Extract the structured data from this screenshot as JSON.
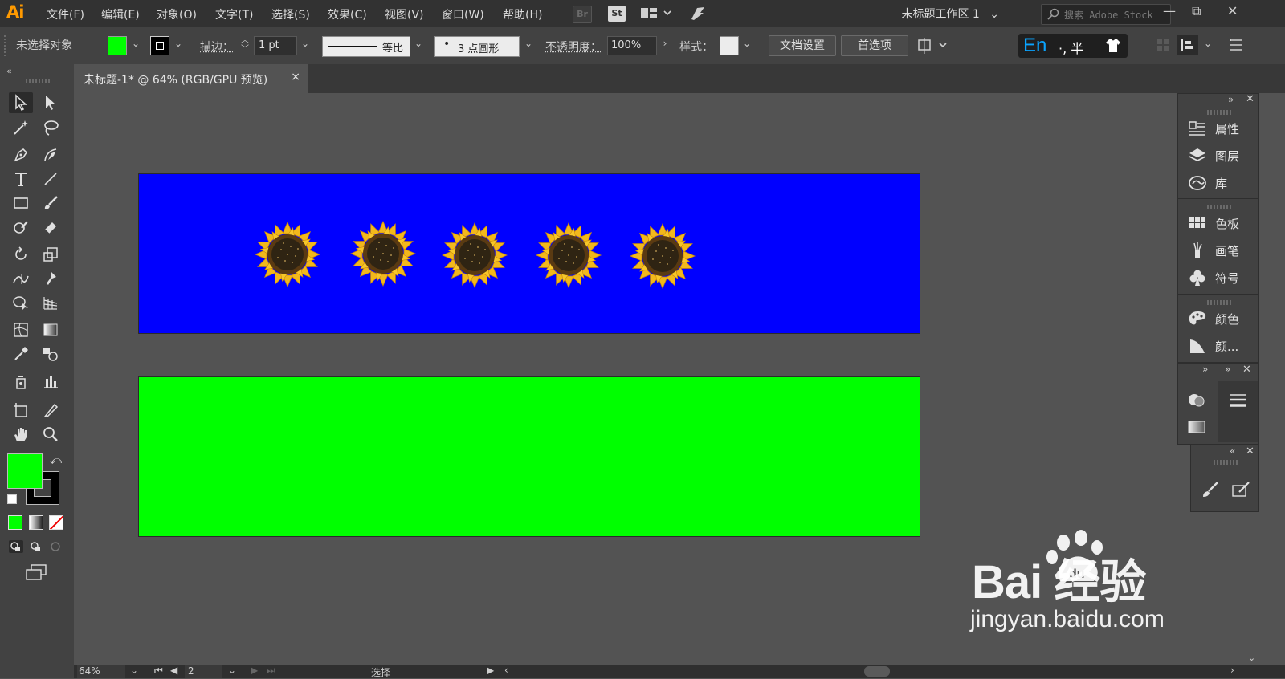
{
  "app": {
    "logo": "Ai",
    "menus": [
      "文件(F)",
      "编辑(E)",
      "对象(O)",
      "文字(T)",
      "选择(S)",
      "效果(C)",
      "视图(V)",
      "窗口(W)",
      "帮助(H)"
    ],
    "bridge_button": "Br",
    "stock_button": "St",
    "workspace": "未标题工作区 1",
    "search_placeholder": "搜索 Adobe Stock"
  },
  "control_bar": {
    "selection_status": "未选择对象",
    "fill_color": "#00ff00",
    "stroke_label": "描边：",
    "stroke_weight": "1 pt",
    "stroke_profile": "等比",
    "brush": "3 点圆形",
    "opacity_label": "不透明度：",
    "opacity_value": "100%",
    "style_label": "样式：",
    "doc_setup_button": "文档设置",
    "preferences_button": "首选项",
    "ime_indicator": "En ·, 半"
  },
  "document": {
    "tab_title": "未标题-1* @ 64% (RGB/GPU 预览)",
    "tab_close": "×"
  },
  "canvas": {
    "artboard1_color": "#0000ff",
    "artboard2_color": "#00ff00",
    "sunflower_count": 5
  },
  "panels": {
    "group1": [
      "属性",
      "图层",
      "库"
    ],
    "group2": [
      "色板",
      "画笔",
      "符号"
    ],
    "group3": [
      "颜色",
      "颜..."
    ]
  },
  "status_bar": {
    "zoom": "64%",
    "artboard_number": "2",
    "mode": "选择"
  },
  "watermark": {
    "brand": "Bai  经验",
    "url": "jingyan.baidu.com"
  }
}
